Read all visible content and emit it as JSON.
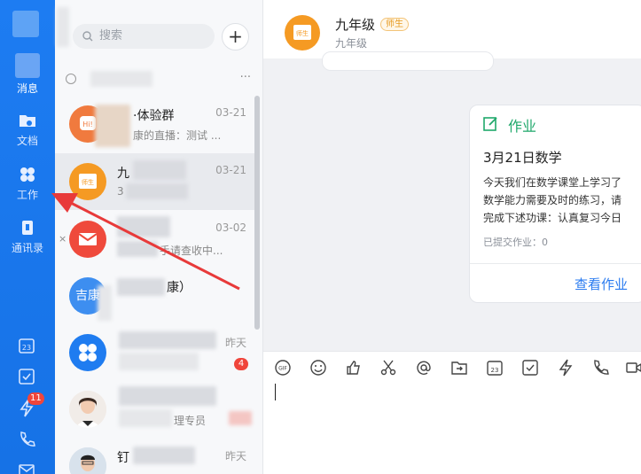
{
  "rail": {
    "items": [
      {
        "label": "消息",
        "icon": "chat-icon"
      },
      {
        "label": "文档",
        "icon": "folder-icon"
      },
      {
        "label": "工作",
        "icon": "grid-icon"
      },
      {
        "label": "通讯录",
        "icon": "contacts-icon"
      }
    ],
    "bottom_badge": "11"
  },
  "list": {
    "search_placeholder": "搜索",
    "add_label": "+",
    "more_label": "···",
    "conversations": [
      {
        "name": "·体验群",
        "preview": "康的直播：测试 ...",
        "time": "03-21",
        "avatar_text": "",
        "avatar_color": "#f07a3e"
      },
      {
        "name": "九",
        "preview": "3",
        "time": "03-21",
        "avatar_text": "师生",
        "avatar_color": "#f59a23"
      },
      {
        "name": "",
        "preview": "手请查收中...",
        "time": "03-02",
        "avatar_text": "",
        "avatar_color": "#ef4a3c"
      },
      {
        "name": "康）",
        "preview": "",
        "time": "",
        "avatar_text": "吉康",
        "avatar_color": "#3d8ef0"
      },
      {
        "name": "",
        "preview": "",
        "time": "昨天",
        "avatar_text": "",
        "avatar_color": "#1f7cf0",
        "badge": "4"
      },
      {
        "name": "",
        "preview": "理专员",
        "time": "",
        "avatar_text": "",
        "avatar_color": "#d9b8a8"
      },
      {
        "name": "钉",
        "preview": "",
        "time": "昨天",
        "avatar_text": "",
        "avatar_color": "#c8d4e0"
      }
    ],
    "close_label": "×"
  },
  "chat": {
    "title": "九年级",
    "tag": "师生",
    "subtitle": "九年级",
    "avatar_text": "师生",
    "homework": {
      "header": "作业",
      "title": "3月21日数学",
      "body_lines": [
        "今天我们在数学课堂上学习了",
        "数学能力需要及时的练习，请",
        "完成下述功课：认真复习今日"
      ],
      "submitted": "已提交作业：0",
      "view_label": "查看作业"
    },
    "toolbar": [
      "gif-icon",
      "emoji-icon",
      "thumbs-up-icon",
      "scissors-icon",
      "at-icon",
      "folder-send-icon",
      "calendar-icon",
      "checkbox-icon",
      "lightning-icon",
      "phone-icon",
      "video-icon"
    ],
    "gif_label": "GIF"
  },
  "colors": {
    "rail": "#1d7cf2",
    "accent_green": "#1fa86b",
    "link_blue": "#2a7bf0",
    "annotation_red": "#e83a3a"
  }
}
